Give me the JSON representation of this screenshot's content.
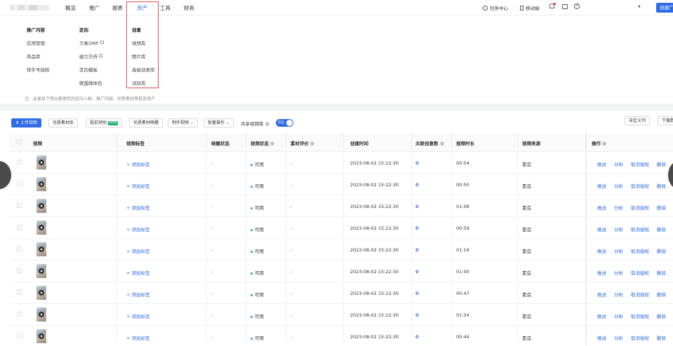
{
  "nav": {
    "items": [
      "概览",
      "推广",
      "报表",
      "资产",
      "工具",
      "财务"
    ],
    "active_index": 3
  },
  "topright": {
    "task_center": "任务中心",
    "mobile": "移动端",
    "create_label": "创建广"
  },
  "mega_menu": {
    "columns": [
      {
        "head": "推广内容",
        "links": [
          "应用管理",
          "商品库",
          "快手号授权"
        ]
      },
      {
        "head": "定向",
        "links": [
          "万象DMP",
          "磁力方舟",
          "定向模板",
          "联盟媒体包"
        ]
      },
      {
        "head": "创意",
        "links": [
          "视频库",
          "图片库",
          "高级创意库",
          "试玩库"
        ]
      }
    ],
    "external_links": [
      "万象DMP",
      "磁力方舟"
    ],
    "note": "注：此类目下用以管理您的定向人群、推广内容、创意素材等投放资产"
  },
  "toolbar": {
    "upload": "上传视频",
    "quality_lib": "优质素材库",
    "predict": "投前预估",
    "beta": "Beta",
    "awaken": "优质素材唤醒",
    "make_video": "制作视频",
    "batch": "批量操作",
    "share_label": "共享视频库",
    "toggle_text": "开启",
    "custom_cols": "自定义列",
    "download": "下载数"
  },
  "table": {
    "headers": [
      "视频",
      "视频标签",
      "唤醒状态",
      "视频状态",
      "素材评价",
      "创建时间",
      "关联创意数",
      "视频时长",
      "视频来源",
      "操作"
    ],
    "rows": [
      {
        "tag": "+ 添加标签",
        "awaken": "-",
        "status": "可用",
        "eval": "-",
        "created": "2023-08-02 15:22:30",
        "creatives": "0",
        "duration": "00:54",
        "source": "素造"
      },
      {
        "tag": "+ 添加标签",
        "awaken": "-",
        "status": "可用",
        "eval": "-",
        "created": "2023-08-02 15:22:30",
        "creatives": "0",
        "duration": "00:50",
        "source": "素造"
      },
      {
        "tag": "+ 添加标签",
        "awaken": "-",
        "status": "可用",
        "eval": "-",
        "created": "2023-08-02 15:22:30",
        "creatives": "0",
        "duration": "01:08",
        "source": "素造"
      },
      {
        "tag": "+ 添加标签",
        "awaken": "-",
        "status": "可用",
        "eval": "-",
        "created": "2023-08-02 15:22:30",
        "creatives": "0",
        "duration": "00:59",
        "source": "素造"
      },
      {
        "tag": "+ 添加标签",
        "awaken": "-",
        "status": "可用",
        "eval": "-",
        "created": "2023-08-02 15:22:30",
        "creatives": "0",
        "duration": "01:16",
        "source": "素造"
      },
      {
        "tag": "+ 添加标签",
        "awaken": "-",
        "status": "可用",
        "eval": "-",
        "created": "2023-08-02 15:22:30",
        "creatives": "0",
        "duration": "01:00",
        "source": "素造"
      },
      {
        "tag": "+ 添加标签",
        "awaken": "-",
        "status": "可用",
        "eval": "-",
        "created": "2023-08-02 15:22:30",
        "creatives": "0",
        "duration": "00:47",
        "source": "素造"
      },
      {
        "tag": "+ 添加标签",
        "awaken": "-",
        "status": "可用",
        "eval": "-",
        "created": "2023-08-02 15:22:30",
        "creatives": "0",
        "duration": "01:34",
        "source": "素造"
      },
      {
        "tag": "+ 添加标签",
        "awaken": "-",
        "status": "可用",
        "eval": "-",
        "created": "2023-08-02 15:22:30",
        "creatives": "0",
        "duration": "00:44",
        "source": "素造"
      }
    ],
    "ops": [
      "推送",
      "分析",
      "取消授权",
      "删除"
    ]
  },
  "colors": {
    "accent": "#2e6be6",
    "highlight_box": "#d9534f",
    "success": "#20b26b"
  }
}
